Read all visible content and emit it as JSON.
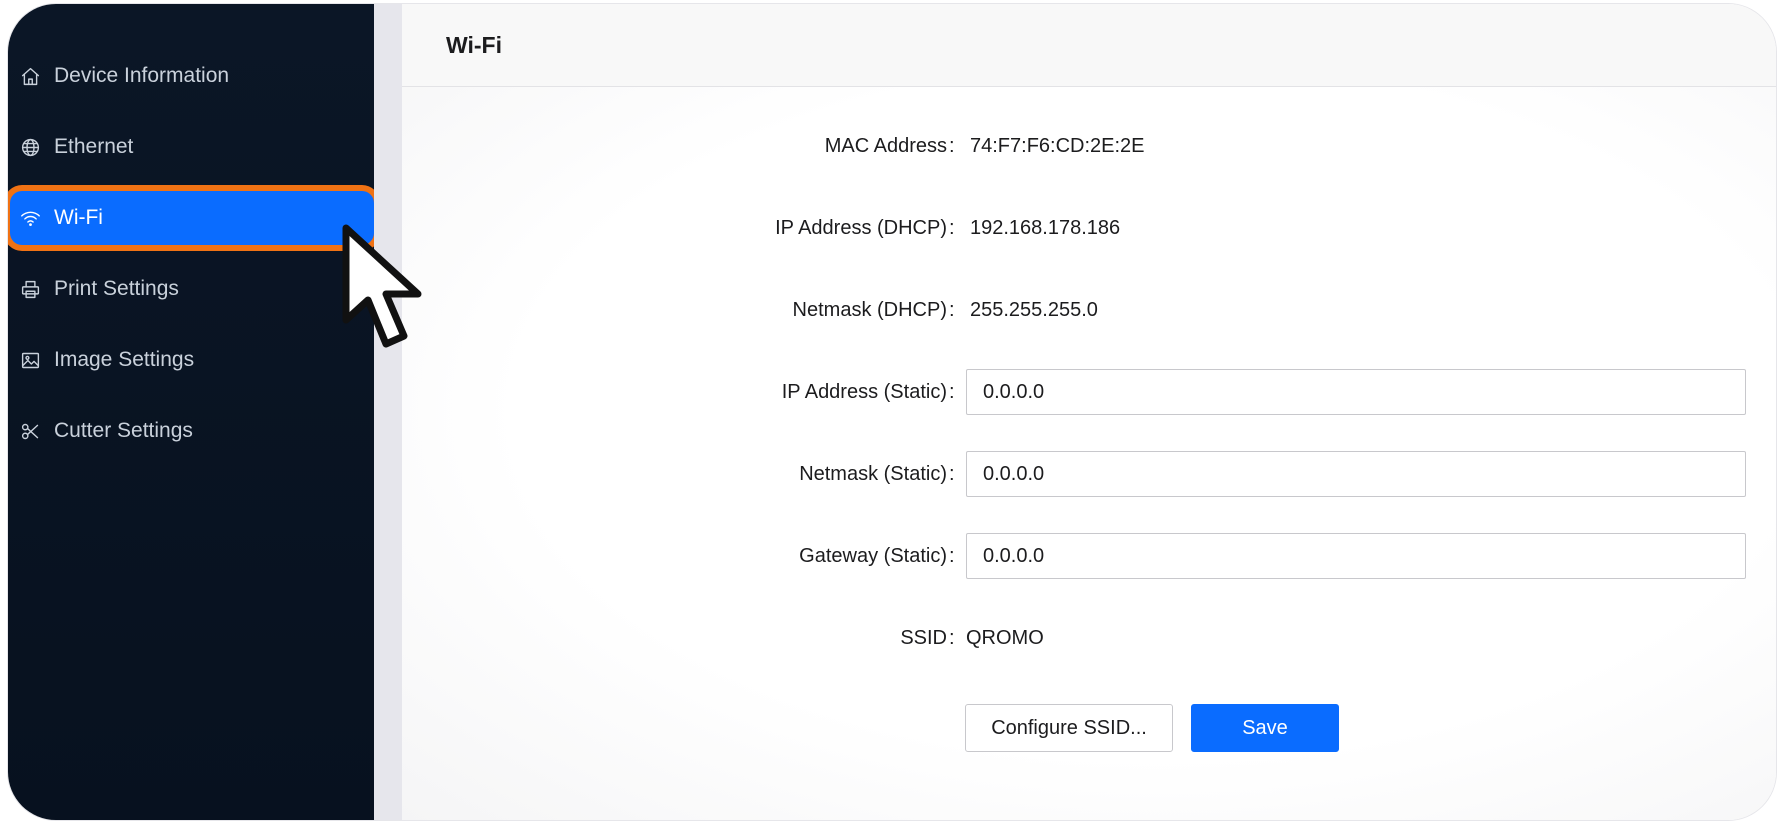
{
  "sidebar": {
    "items": [
      {
        "label": "Device Information",
        "icon": "home-icon",
        "active": false
      },
      {
        "label": "Ethernet",
        "icon": "globe-icon",
        "active": false
      },
      {
        "label": "Wi-Fi",
        "icon": "wifi-icon",
        "active": true
      },
      {
        "label": "Print Settings",
        "icon": "printer-icon",
        "active": false
      },
      {
        "label": "Image Settings",
        "icon": "image-icon",
        "active": false
      },
      {
        "label": "Cutter Settings",
        "icon": "scissors-icon",
        "active": false
      }
    ]
  },
  "page": {
    "title": "Wi-Fi"
  },
  "form": {
    "separator": ":",
    "mac": {
      "label": "MAC Address",
      "value": "74:F7:F6:CD:2E:2E"
    },
    "ip_dhcp": {
      "label": "IP Address (DHCP)",
      "value": "192.168.178.186"
    },
    "netmask_dhcp": {
      "label": "Netmask (DHCP)",
      "value": "255.255.255.0"
    },
    "ip_static": {
      "label": "IP Address (Static)",
      "value": "0.0.0.0"
    },
    "netmask_static": {
      "label": "Netmask (Static)",
      "value": "0.0.0.0"
    },
    "gateway_static": {
      "label": "Gateway (Static)",
      "value": "0.0.0.0"
    },
    "ssid": {
      "label": "SSID",
      "value": "QROMO"
    }
  },
  "actions": {
    "configure_ssid_label": "Configure SSID...",
    "save_label": "Save"
  },
  "colors": {
    "accent": "#0a6cff",
    "highlight": "#f07214",
    "sidebar_bg": "#0b1626"
  }
}
